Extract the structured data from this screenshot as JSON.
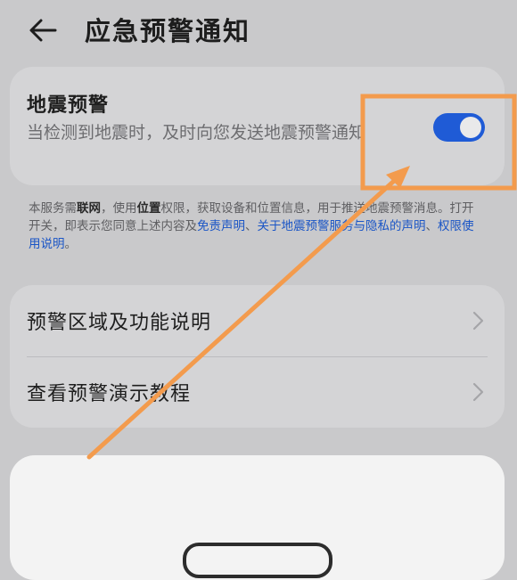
{
  "header": {
    "title": "应急预警通知",
    "back_icon": "arrow-left-icon"
  },
  "earthquake_alert": {
    "title": "地震预警",
    "description": "当检测到地震时，及时向您发送地震预警通知",
    "toggle_on": true,
    "toggle_color": "#1f5bd6"
  },
  "note": {
    "p1": "本服务需",
    "b1": "联网",
    "p2": "，使用",
    "b2": "位置",
    "p3": "权限，获取设备和位置信息，用于推送地震预警消息。打开开关，即表示您同意上述内容及",
    "link1": "免责声明",
    "p4": "、",
    "link2": "关于地震预警服务与隐私的声明",
    "p5": "、",
    "link3": "权限使用说明",
    "p6": "。"
  },
  "menu": {
    "items": [
      {
        "label": "预警区域及功能说明",
        "icon": "chevron-right-icon"
      },
      {
        "label": "查看预警演示教程",
        "icon": "chevron-right-icon"
      }
    ]
  },
  "annotation_color": "#f39b4d"
}
